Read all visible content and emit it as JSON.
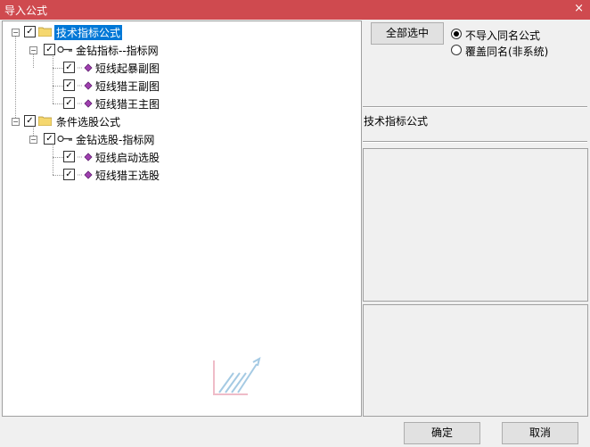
{
  "window": {
    "title": "导入公式",
    "close_glyph": "×"
  },
  "tree": {
    "groups": [
      {
        "label": "技术指标公式",
        "checked": true,
        "selected": true,
        "sub": {
          "label": "金钻指标--指标网",
          "checked": true,
          "items": [
            {
              "label": "短线起暴副图",
              "checked": true
            },
            {
              "label": "短线猎王副图",
              "checked": true
            },
            {
              "label": "短线猎王主图",
              "checked": true
            }
          ]
        }
      },
      {
        "label": "条件选股公式",
        "checked": true,
        "selected": false,
        "sub": {
          "label": "金钻选股-指标网",
          "checked": true,
          "items": [
            {
              "label": "短线启动选股",
              "checked": true
            },
            {
              "label": "短线猎王选股",
              "checked": true
            }
          ]
        }
      }
    ]
  },
  "right": {
    "select_all_label": "全部选中",
    "options": [
      {
        "label": "不导入同名公式",
        "selected": true
      },
      {
        "label": "覆盖同名(非系统)",
        "selected": false
      }
    ],
    "formula_name": "技术指标公式"
  },
  "footer": {
    "ok_label": "确定",
    "cancel_label": "取消"
  },
  "colors": {
    "titlebar": "#cf4a4f",
    "selection": "#0078d7",
    "folder": "#f5d76e",
    "gem": "#a040b0"
  }
}
